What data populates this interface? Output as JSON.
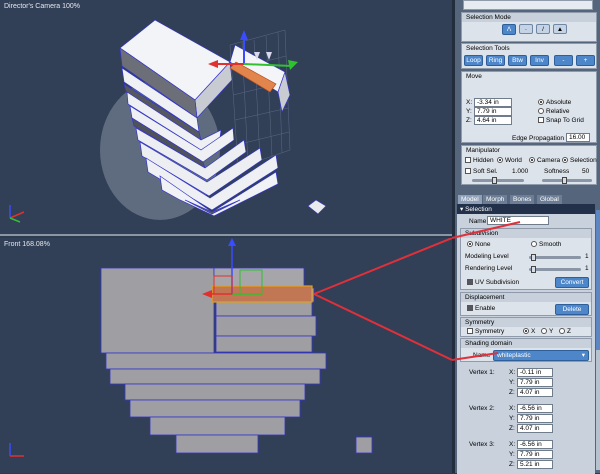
{
  "viewports": {
    "top": {
      "label": "Director's Camera 100%"
    },
    "bottom": {
      "label": "Front 168.08%"
    }
  },
  "selection_mode": {
    "title": "Selection Mode"
  },
  "selection_tools": {
    "title": "Selection Tools",
    "buttons": [
      "Loop",
      "Ring",
      "Btw",
      "Inv",
      "-",
      "+"
    ]
  },
  "move": {
    "title": "Move",
    "x": "-3.34 in",
    "y": "7.79 in",
    "z": "4.64 in",
    "x_label": "X:",
    "y_label": "Y:",
    "z_label": "Z:",
    "absolute": "Absolute",
    "relative": "Relative",
    "snap": "Snap To Grid",
    "edge_propagation_label": "Edge Propagation",
    "edge_propagation": "16.00"
  },
  "manipulator": {
    "title": "Manipulator",
    "hidden": "Hidden",
    "world": "World",
    "camera": "Camera",
    "selection": "Selection",
    "soft_sel": "Soft Sel.",
    "soft_sel_value": "1.000",
    "softness": "Softness",
    "softness_value": "50"
  },
  "tabs": [
    "Model",
    "Morph",
    "Bones",
    "Global"
  ],
  "model": {
    "selection_header": "Selection",
    "name_label": "Name",
    "name_value": "WHITE",
    "subdivision_title": "Subdivision",
    "none": "None",
    "smooth": "Smooth",
    "modeling_level": "Modeling Level",
    "modeling_value": "1",
    "rendering_level": "Rendering Level",
    "rendering_value": "1",
    "uv_subdivision": "UV Subdivision",
    "convert": "Convert",
    "displacement_title": "Displacement",
    "enable": "Enable",
    "delete": "Delete",
    "symmetry_title": "Symmetry",
    "symmetry": "Symmetry",
    "sx": "X",
    "sy": "Y",
    "sz": "Z",
    "shading_title": "Shading domain",
    "shading_name_label": "Name",
    "shading_name": "whiteplastic",
    "vertices": [
      {
        "label": "Vertex 1:",
        "x": "-0.11 in",
        "y": "7.79 in",
        "z": "4.07 in"
      },
      {
        "label": "Vertex 2:",
        "x": "-6.56 in",
        "y": "7.79 in",
        "z": "4.07 in"
      },
      {
        "label": "Vertex 3:",
        "x": "-6.56 in",
        "y": "7.79 in",
        "z": "5.21 in"
      }
    ],
    "x_label": "X:",
    "y_label": "Y:",
    "z_label": "Z:"
  },
  "colors": {
    "viewport_bg": "#313f57",
    "panel_bg": "#55657c",
    "accent_red": "#e0303a",
    "selection_orange": "#e08a4a"
  }
}
